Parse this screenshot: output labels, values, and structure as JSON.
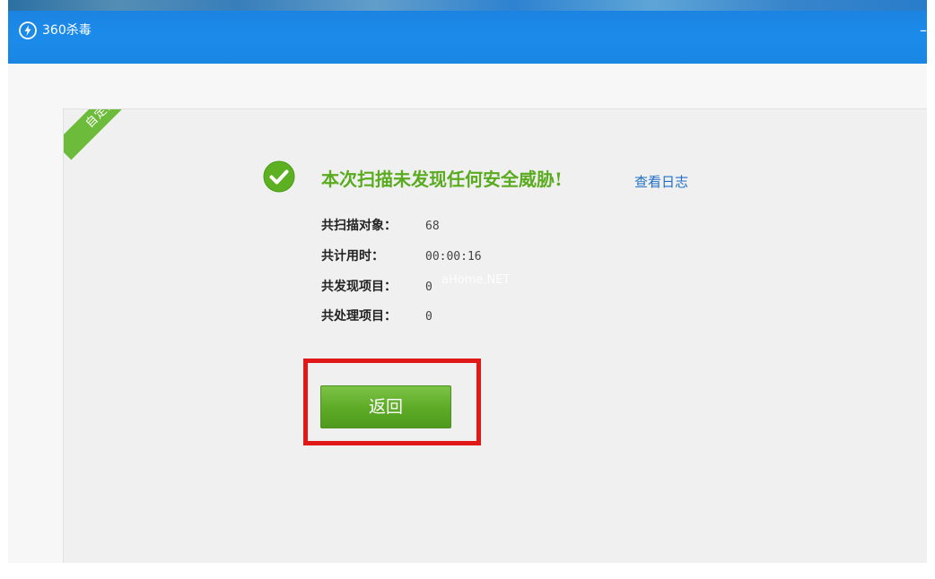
{
  "window": {
    "app_title": "360杀毒",
    "minimize_glyph": "–",
    "icons": {
      "app_icon": "shield-lightning-icon",
      "result_icon": "check-circle-icon"
    }
  },
  "panel": {
    "ribbon_label": "自定义扫描",
    "result_title": "本次扫描未发现任何安全威胁!",
    "view_log_link": "查看日志",
    "stats": [
      {
        "label": "共扫描对象：",
        "value": "68"
      },
      {
        "label": "共计用时：",
        "value": "00:00:16"
      },
      {
        "label": "共发现项目：",
        "value": "0"
      },
      {
        "label": "共处理项目：",
        "value": "0"
      }
    ],
    "watermark": "aHome.NET",
    "back_button_label": "返回"
  },
  "colors": {
    "titlebar": "#1b8bea",
    "success_green": "#5aab1f",
    "link_blue": "#1f6fc5",
    "highlight_red": "#e01818"
  }
}
